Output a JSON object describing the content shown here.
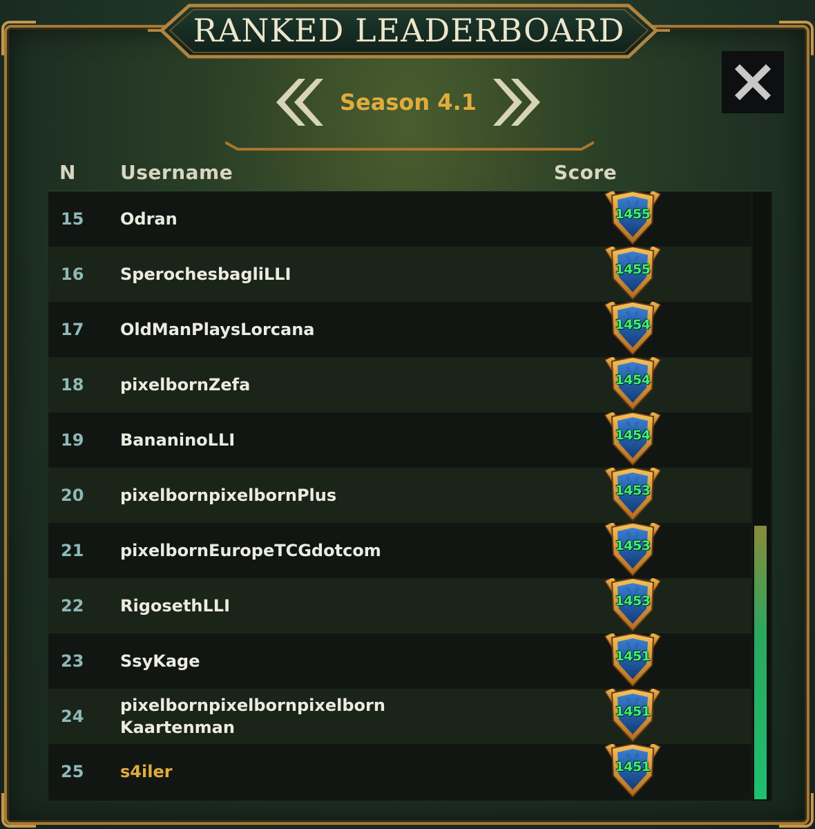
{
  "title": "RANKED LEADERBOARD",
  "season": {
    "label": "Season 4.1"
  },
  "columns": {
    "rank": "N",
    "username": "Username",
    "score": "Score"
  },
  "rows": [
    {
      "rank": "15",
      "username": "Odran",
      "score": "1455"
    },
    {
      "rank": "16",
      "username": "SperochesbagliLLI",
      "score": "1455"
    },
    {
      "rank": "17",
      "username": "OldManPlaysLorcana",
      "score": "1454"
    },
    {
      "rank": "18",
      "username": "pixelbornZefa",
      "score": "1454"
    },
    {
      "rank": "19",
      "username": "BananinoLLI",
      "score": "1454"
    },
    {
      "rank": "20",
      "username": "pixelbornpixelbornPlus",
      "score": "1453"
    },
    {
      "rank": "21",
      "username": "pixelbornEuropeTCGdotcom",
      "score": "1453"
    },
    {
      "rank": "22",
      "username": "RigosethLLI",
      "score": "1453"
    },
    {
      "rank": "23",
      "username": "SsyKage",
      "score": "1451"
    },
    {
      "rank": "24",
      "username": "pixelbornpixelbornpixelborn\nKaartenman",
      "score": "1451"
    },
    {
      "rank": "25",
      "username": "s4iler",
      "score": "1451",
      "is_current_user": true
    }
  ],
  "icons": {
    "close": "close-icon",
    "prev": "chevron-double-left-icon",
    "next": "chevron-double-right-icon",
    "badge": "rank-shield-icon"
  },
  "colors": {
    "gold": "#e0ac3e",
    "score_green": "#3df07a",
    "rank_teal": "#8fb8b8"
  }
}
